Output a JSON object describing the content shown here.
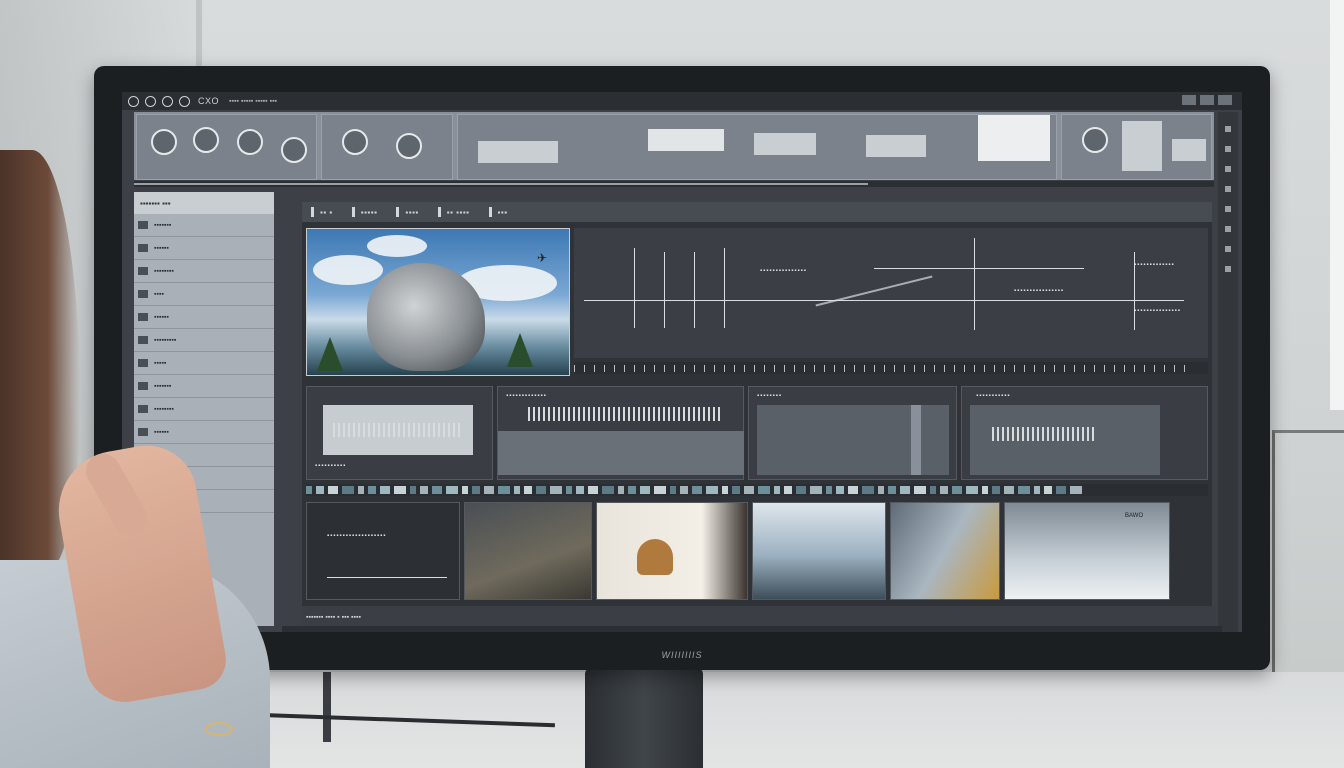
{
  "monitor": {
    "brand": "WIIIIIIIS"
  },
  "app": {
    "title": "CXO",
    "menu_text": "▪▪▪▪ ▪▪▪▪▪ ▪▪▪▪▪ ▪▪▪",
    "zoom": ""
  },
  "left_panel": {
    "header": "▪▪▪▪▪▪▪ ▪▪▪",
    "items": [
      "▪▪▪▪▪▪▪",
      "▪▪▪▪▪▪",
      "▪▪▪▪▪▪▪▪",
      "▪▪▪▪",
      "▪▪▪▪▪▪",
      "▪▪▪▪▪▪▪▪▪",
      "▪▪▪▪▪",
      "▪▪▪▪▪▪▪",
      "▪▪▪▪▪▪▪▪",
      "▪▪▪▪▪▪",
      "▪▪▪▪▪▪▪▪",
      "▪▪▪▪▪",
      "▪▪▪▪▪▪"
    ]
  },
  "toolbar": {
    "labels": [
      "▪▪ ▪",
      "▪▪▪▪▪",
      "▪▪▪▪",
      "▪▪ ▪▪▪▪",
      "▪▪▪"
    ]
  },
  "timeline": {
    "annotations": [
      "▪▪▪▪▪▪▪▪▪▪▪▪▪▪▪",
      "▪▪▪▪▪▪▪▪▪▪▪▪▪▪▪▪",
      "▪▪▪▪▪▪▪▪▪▪▪▪▪",
      "▪▪▪▪▪▪▪▪▪▪▪▪▪▪▪"
    ]
  },
  "clips": [
    {
      "label": "▪▪▪▪▪▪▪▪▪▪"
    },
    {
      "label": "▪▪▪▪▪▪▪▪▪▪▪▪▪"
    },
    {
      "label": "▪▪▪▪▪▪▪▪"
    },
    {
      "label": "▪▪▪▪▪▪▪▪▪▪▪"
    }
  ],
  "thumbnails": [
    {
      "label": "▪▪▪▪▪▪▪▪▪▪▪▪▪▪▪▪▪▪▪"
    },
    {
      "label": ""
    },
    {
      "label": ""
    },
    {
      "label": ""
    },
    {
      "label": ""
    },
    {
      "label": "BAWO"
    }
  ],
  "bottom": {
    "status": "▪▪▪▪▪▪▪ ▪▪▪▪ ▪ ▪▪▪ ▪▪▪▪"
  },
  "colors": {
    "panel": "#3d4147",
    "accent": "#9aa0a6",
    "left_panel": "#aab0b7"
  }
}
